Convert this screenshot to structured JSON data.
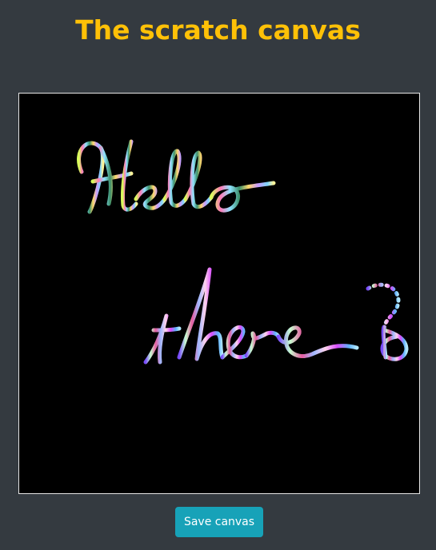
{
  "page": {
    "title": "The scratch canvas"
  },
  "canvas": {
    "background": "#000000",
    "border_color": "#e6e6e6"
  },
  "actions": {
    "save_label": "Save canvas"
  },
  "theme": {
    "page_background": "#343a40",
    "title_color": "#ffc107",
    "button_color": "#17a2b8"
  }
}
